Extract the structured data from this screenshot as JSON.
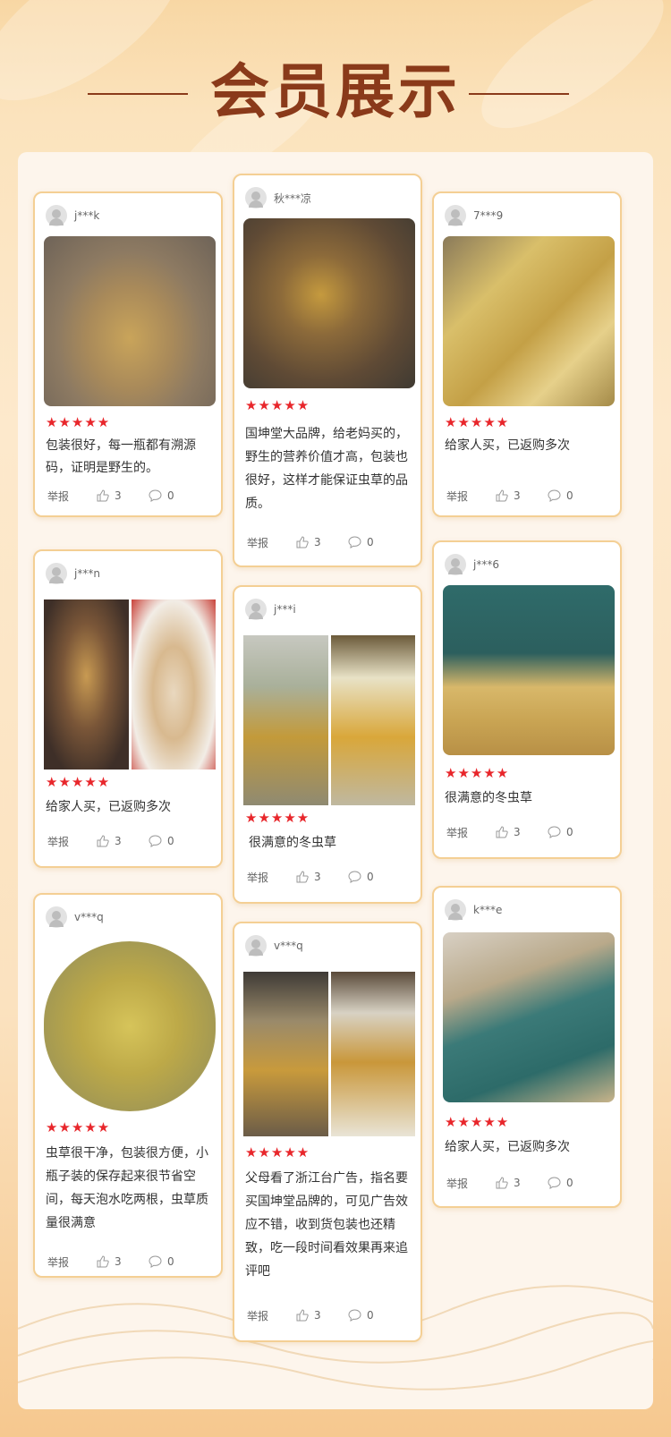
{
  "header": {
    "title": "会员展示"
  },
  "colors": {
    "accent": "#8a3a1a",
    "star": "#e8262b",
    "card_border": "#f4cf94"
  },
  "icons": {
    "like": "thumbs-up-icon",
    "comment": "comment-bubble-icon",
    "avatar": "default-avatar-icon"
  },
  "reviews": [
    {
      "user": "j***k",
      "stars": "★★★★★",
      "rating": 5,
      "text": "包装很好，每一瓶都有溯源码，证明是野生的。",
      "report": "举报",
      "likes": "3",
      "comments": "0"
    },
    {
      "user": "秋***凉",
      "stars": "★★★★★",
      "rating": 5,
      "text": "国坤堂大品牌，给老妈买的，野生的营养价值才高，包装也很好，这样才能保证虫草的品质。",
      "report": "举报",
      "likes": "3",
      "comments": "0"
    },
    {
      "user": "7***9",
      "stars": "★★★★★",
      "rating": 5,
      "text": "给家人买，已返购多次",
      "report": "举报",
      "likes": "3",
      "comments": "0"
    },
    {
      "user": "j***n",
      "stars": "★★★★★",
      "rating": 5,
      "text": "给家人买，已返购多次",
      "report": "举报",
      "likes": "3",
      "comments": "0"
    },
    {
      "user": "j***i",
      "stars": "★★★★★",
      "rating": 5,
      "text": "很满意的冬虫草",
      "report": "举报",
      "likes": "3",
      "comments": "0"
    },
    {
      "user": "j***6",
      "stars": "★★★★★",
      "rating": 5,
      "text": "很满意的冬虫草",
      "report": "举报",
      "likes": "3",
      "comments": "0"
    },
    {
      "user": "v***q",
      "stars": "★★★★★",
      "rating": 5,
      "text": "虫草很干净，包装很方便，小瓶子装的保存起来很节省空间，每天泡水吃两根，虫草质量很满意",
      "report": "举报",
      "likes": "3",
      "comments": "0"
    },
    {
      "user": "v***q",
      "stars": "★★★★★",
      "rating": 5,
      "text": "父母看了浙江台广告，指名要买国坤堂品牌的，可见广告效应不错，收到货包装也还精致，吃一段时间看效果再来追评吧",
      "report": "举报",
      "likes": "3",
      "comments": "0"
    },
    {
      "user": "k***e",
      "stars": "★★★★★",
      "rating": 5,
      "text": "给家人买，已返购多次",
      "report": "举报",
      "likes": "3",
      "comments": "0"
    }
  ]
}
